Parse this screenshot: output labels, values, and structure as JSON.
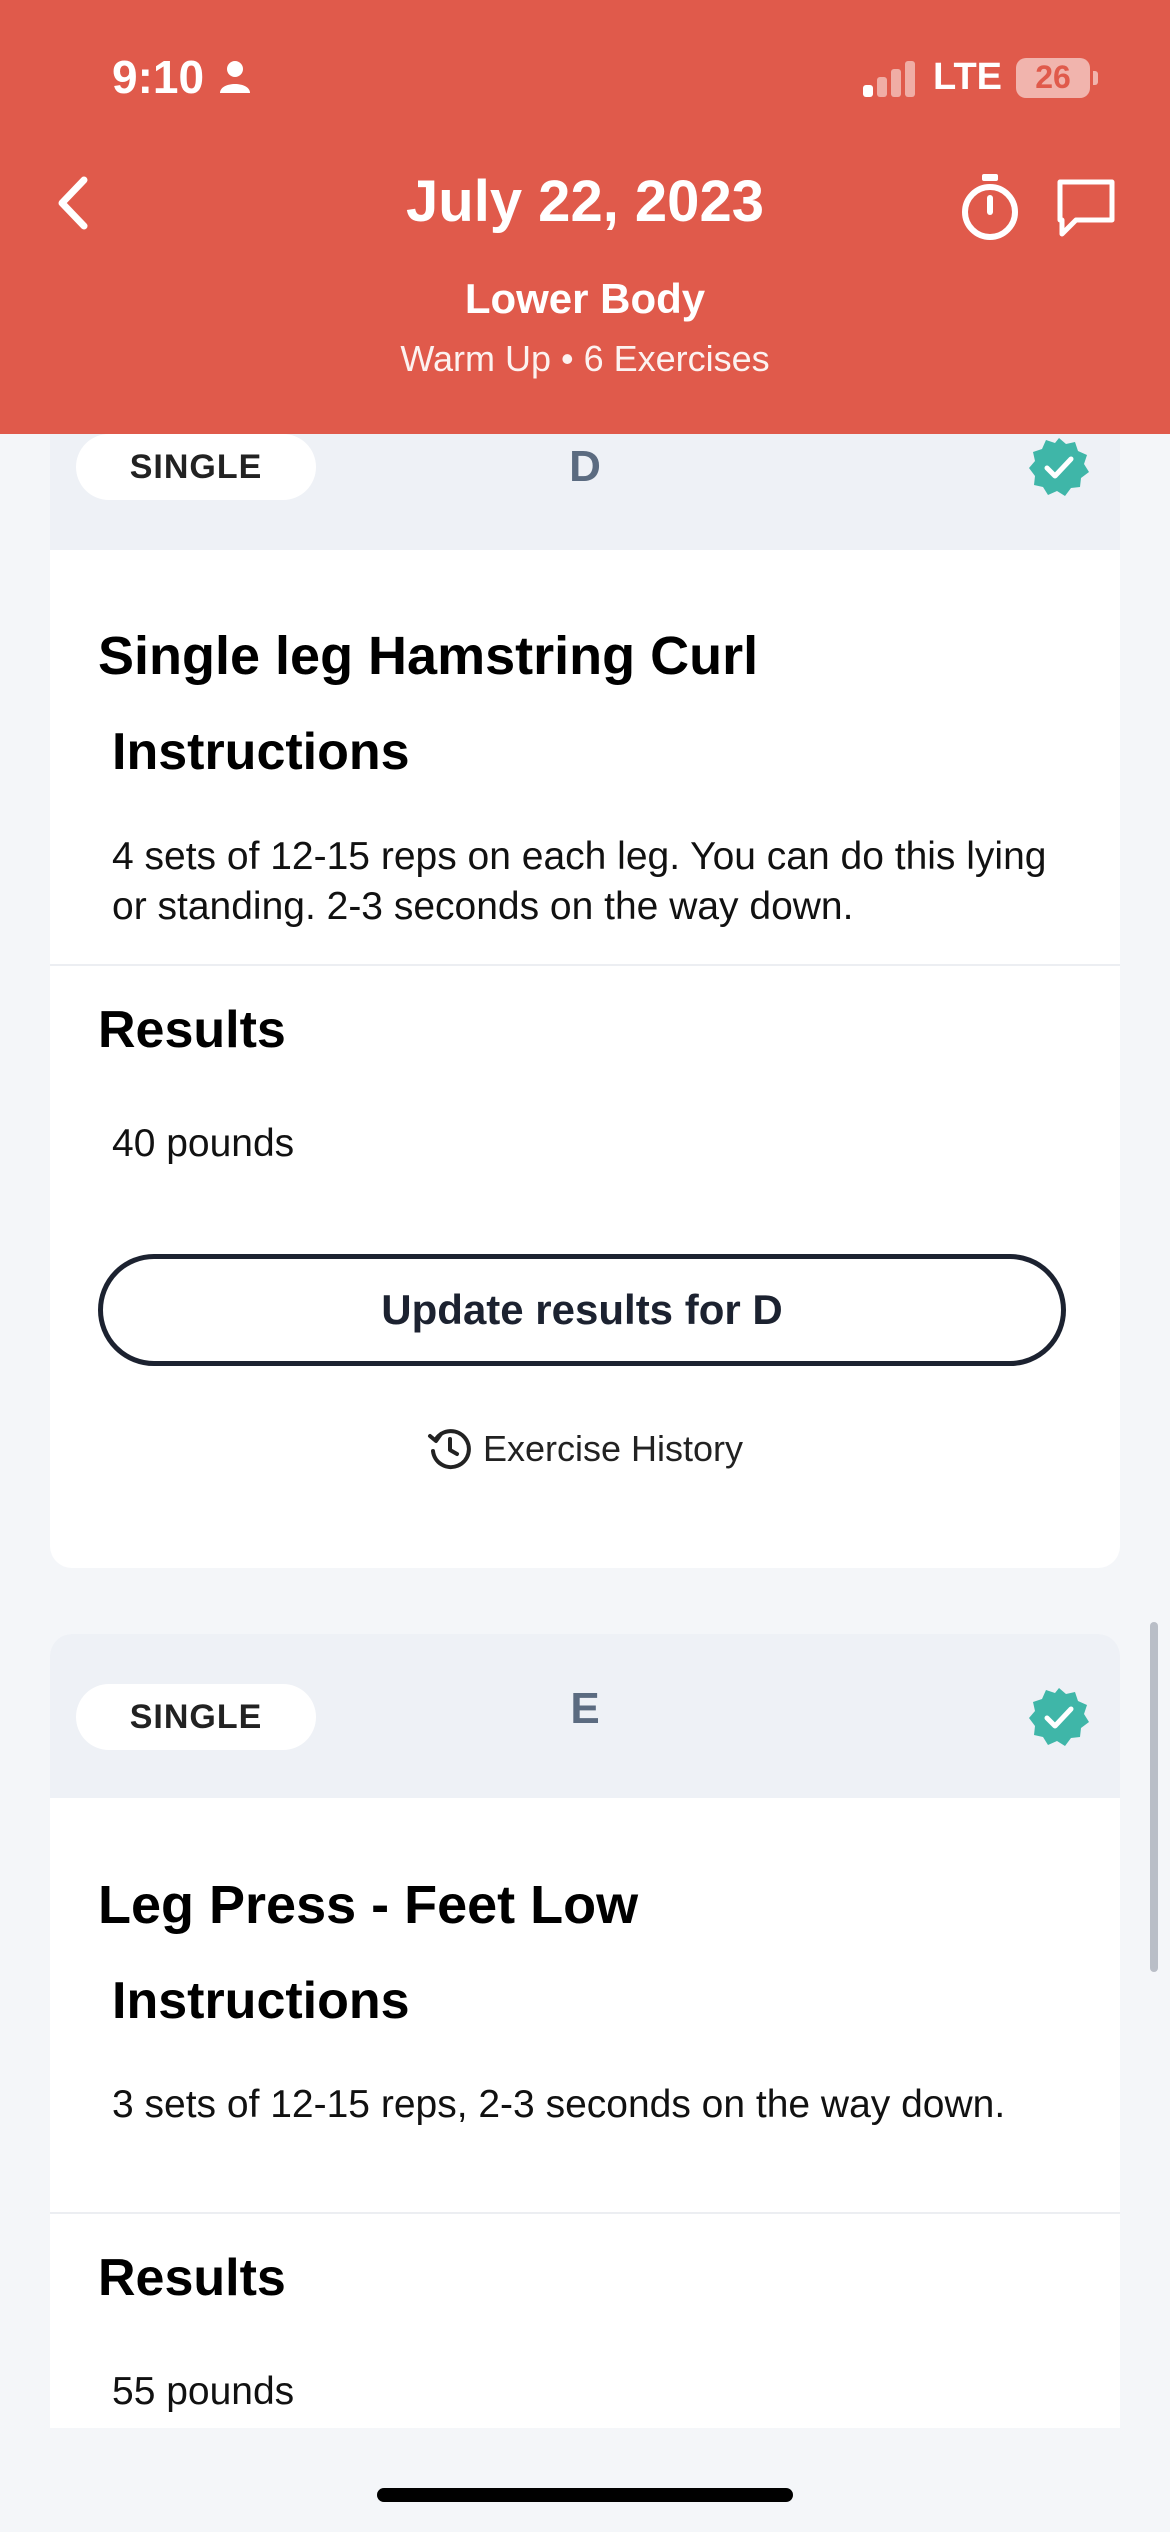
{
  "status_bar": {
    "time": "9:10",
    "network": "LTE",
    "battery": "26"
  },
  "header": {
    "title": "July 22, 2023",
    "workout_name": "Lower Body",
    "workout_meta": "Warm Up • 6 Exercises"
  },
  "exercises": [
    {
      "type": "SINGLE",
      "letter": "D",
      "completed": true,
      "name": "Single leg Hamstring Curl",
      "instructions_title": "Instructions",
      "instructions": "4 sets of 12-15 reps on each leg. You can do this lying or standing. 2-3 seconds on the way down.",
      "results_title": "Results",
      "result_value": "40 pounds",
      "update_label": "Update results for D",
      "history_label": "Exercise History"
    },
    {
      "type": "SINGLE",
      "letter": "E",
      "completed": true,
      "name": "Leg Press - Feet Low",
      "instructions_title": "Instructions",
      "instructions": "3 sets of 12-15 reps, 2-3 seconds on the way down.",
      "results_title": "Results",
      "result_value": "55 pounds"
    }
  ],
  "colors": {
    "header_bg": "#e05a4b",
    "check": "#3fb6a8",
    "button_border": "#1c2230"
  }
}
